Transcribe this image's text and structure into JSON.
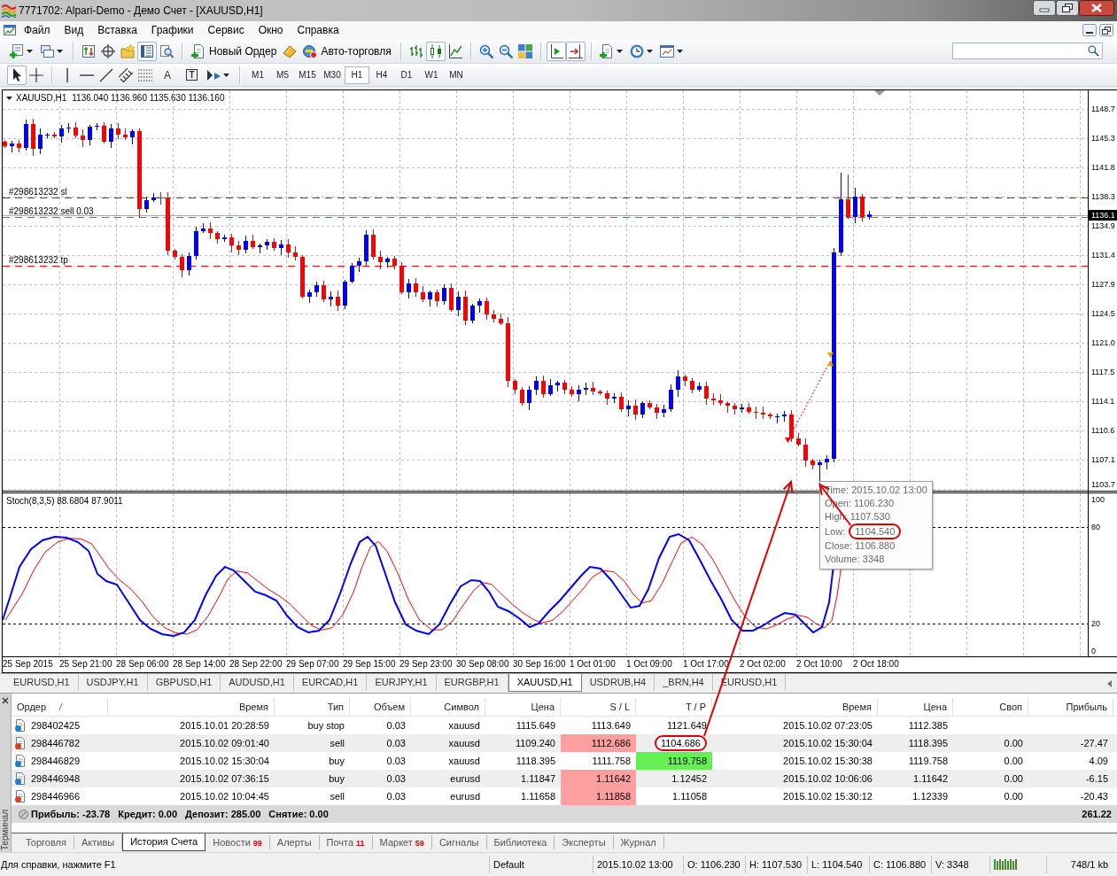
{
  "window": {
    "title": "7771702: Alpari-Demo - Демо Счет - [XAUUSD,H1]"
  },
  "menu": [
    "Файл",
    "Вид",
    "Вставка",
    "Графики",
    "Сервис",
    "Окно",
    "Справка"
  ],
  "toolbar": {
    "terminal_pressed": true,
    "new_order": "Новый Ордер",
    "auto_trading": "Авто-торговля",
    "chart_types": [
      {
        "kind": "bars",
        "selected": false
      },
      {
        "kind": "candles",
        "selected": true
      },
      {
        "kind": "line",
        "selected": false
      }
    ],
    "auto_scroll_pressed": true,
    "chart_shift_pressed": true
  },
  "drawing_tools": {
    "cursor_pressed": true,
    "crosshair_pressed": false,
    "text_tool": "A",
    "label_tool": "T"
  },
  "timeframes": [
    {
      "label": "M1",
      "selected": false
    },
    {
      "label": "M5",
      "selected": false
    },
    {
      "label": "M15",
      "selected": false
    },
    {
      "label": "M30",
      "selected": false
    },
    {
      "label": "H1",
      "selected": true
    },
    {
      "label": "H4",
      "selected": false
    },
    {
      "label": "D1",
      "selected": false
    },
    {
      "label": "W1",
      "selected": false
    },
    {
      "label": "MN",
      "selected": false
    }
  ],
  "chart": {
    "symbol": "XAUUSD,H1",
    "ohlc": "1136.040 1136.960 1135.630 1136.160",
    "order_lines": [
      {
        "kind": "sl",
        "label": "#298613232 sl"
      },
      {
        "kind": "entry",
        "label": "#298613232 sell 0.03"
      },
      {
        "kind": "tp",
        "label": "#298613232 tp"
      }
    ],
    "price_axis": [
      {
        "label": "1148.7",
        "current": false
      },
      {
        "label": "1145.3",
        "current": false
      },
      {
        "label": "1141.8",
        "current": false
      },
      {
        "label": "1138.3",
        "current": false
      },
      {
        "label": "1136.1",
        "current": true
      },
      {
        "label": "1134.9",
        "current": false
      },
      {
        "label": "1131.4",
        "current": false
      },
      {
        "label": "1127.9",
        "current": false
      },
      {
        "label": "1124.5",
        "current": false
      },
      {
        "label": "1121.0",
        "current": false
      },
      {
        "label": "1117.5",
        "current": false
      },
      {
        "label": "1114.1",
        "current": false
      },
      {
        "label": "1110.6",
        "current": false
      },
      {
        "label": "1107.1",
        "current": false
      },
      {
        "label": "1103.7",
        "current": false
      }
    ],
    "indicator": {
      "label": "Stoch(8,3,5) 88.6804 87.9011",
      "levels": [
        "100",
        "80",
        "20",
        "0"
      ]
    },
    "time_axis": [
      "25 Sep 2015",
      "25 Sep 21:00",
      "28 Sep 06:00",
      "28 Sep 14:00",
      "28 Sep 22:00",
      "29 Sep 07:00",
      "29 Sep 15:00",
      "29 Sep 23:00",
      "30 Sep 08:00",
      "30 Sep 16:00",
      "1 Oct 01:00",
      "1 Oct 09:00",
      "1 Oct 17:00",
      "2 Oct 02:00",
      "2 Oct 10:00",
      "2 Oct 18:00"
    ],
    "tooltip": [
      {
        "label": "Time:",
        "value": "2015.10.02 13:00",
        "circled": false
      },
      {
        "label": "Open:",
        "value": "1106.230",
        "circled": false
      },
      {
        "label": "High:",
        "value": "1107.530",
        "circled": false
      },
      {
        "label": "Low:",
        "value": "1104.540",
        "circled": true
      },
      {
        "label": "Close:",
        "value": "1106.880",
        "circled": false
      },
      {
        "label": "Volume:",
        "value": "3348",
        "circled": false
      }
    ]
  },
  "chart_tabs": [
    {
      "label": "EURUSD,H1",
      "selected": false
    },
    {
      "label": "USDJPY,H1",
      "selected": false
    },
    {
      "label": "GBPUSD,H1",
      "selected": false
    },
    {
      "label": "AUDUSD,H1",
      "selected": false
    },
    {
      "label": "EURCAD,H1",
      "selected": false
    },
    {
      "label": "EURJPY,H1",
      "selected": false
    },
    {
      "label": "EURGBP,H1",
      "selected": false
    },
    {
      "label": "XAUUSD,H1",
      "selected": true
    },
    {
      "label": "USDRUB,H4",
      "selected": false
    },
    {
      "label": "_BRN,H4",
      "selected": false
    },
    {
      "label": "EURUSD,H1",
      "selected": false
    }
  ],
  "terminal": {
    "title": "Терминал",
    "columns": [
      "Ордер",
      "Время",
      "Тип",
      "Объем",
      "Символ",
      "Цена",
      "S / L",
      "T / P",
      "Время",
      "Цена",
      "Своп",
      "Прибыль"
    ],
    "rows": [
      {
        "order": "298402425",
        "open_time": "2015.10.01 20:28:59",
        "type": "buy stop",
        "volume": "0.03",
        "symbol": "xauusd",
        "open_price": "1115.649",
        "sl": "1113.649",
        "tp": "1121.649",
        "close_time": "2015.10.02 07:23:05",
        "close_price": "1112.385",
        "color": "#1e7fd8",
        "sl_hit": false,
        "tp_hit": false,
        "tp_circled": false
      },
      {
        "order": "298446782",
        "open_time": "2015.10.02 09:01:40",
        "type": "sell",
        "volume": "0.03",
        "symbol": "xauusd",
        "open_price": "1109.240",
        "sl": "1112.686",
        "tp": "1104.686",
        "close_time": "2015.10.02 15:30:04",
        "close_price": "1118.395",
        "swap": "0.00",
        "profit": "-27.47",
        "color": "#e0401a",
        "sl_hit": true,
        "tp_hit": false,
        "tp_circled": true
      },
      {
        "order": "298446829",
        "open_time": "2015.10.02 15:30:04",
        "type": "buy",
        "volume": "0.03",
        "symbol": "xauusd",
        "open_price": "1118.395",
        "sl": "1111.758",
        "tp": "1119.758",
        "close_time": "2015.10.02 15:30:38",
        "close_price": "1119.758",
        "swap": "0.00",
        "profit": "4.09",
        "color": "#1e7fd8",
        "sl_hit": false,
        "tp_hit": true,
        "tp_circled": false
      },
      {
        "order": "298446948",
        "open_time": "2015.10.02 07:36:15",
        "type": "buy",
        "volume": "0.03",
        "symbol": "eurusd",
        "open_price": "1.11847",
        "sl": "1.11642",
        "tp": "1.12452",
        "close_time": "2015.10.02 10:06:06",
        "close_price": "1.11642",
        "swap": "0.00",
        "profit": "-6.15",
        "color": "#1e7fd8",
        "sl_hit": true,
        "tp_hit": false,
        "tp_circled": false
      },
      {
        "order": "298446966",
        "open_time": "2015.10.02 10:04:45",
        "type": "sell",
        "volume": "0.03",
        "symbol": "eurusd",
        "open_price": "1.11658",
        "sl": "1.11858",
        "tp": "1.11058",
        "close_time": "2015.10.02 15:30:12",
        "close_price": "1.12339",
        "swap": "0.00",
        "profit": "-20.43",
        "color": "#e0401a",
        "sl_hit": true,
        "tp_hit": false,
        "tp_circled": false
      }
    ],
    "summary": {
      "items": [
        "Прибыль: -23.78",
        "Кредит: 0.00",
        "Депозит: 285.00",
        "Снятие: 0.00"
      ],
      "total": "261.22"
    },
    "tabs": [
      {
        "label": "Торговля",
        "selected": false
      },
      {
        "label": "Активы",
        "selected": false
      },
      {
        "label": "История Счета",
        "selected": true
      },
      {
        "label": "Новости",
        "badge": "99",
        "selected": false
      },
      {
        "label": "Алерты",
        "selected": false
      },
      {
        "label": "Почта",
        "badge": "11",
        "selected": false
      },
      {
        "label": "Маркет",
        "badge": "59",
        "selected": false
      },
      {
        "label": "Сигналы",
        "selected": false
      },
      {
        "label": "Библиотека",
        "selected": false
      },
      {
        "label": "Эксперты",
        "selected": false
      },
      {
        "label": "Журнал",
        "selected": false
      }
    ]
  },
  "status_bar": {
    "help": "Для справки, нажмите F1",
    "profile": "Default",
    "time": "2015.10.02 13:00",
    "open": "O: 1106.230",
    "high": "H: 1107.530",
    "low": "L: 1104.540",
    "close": "C: 1106.880",
    "volume": "V: 3348",
    "traffic": "748/1 kb"
  }
}
